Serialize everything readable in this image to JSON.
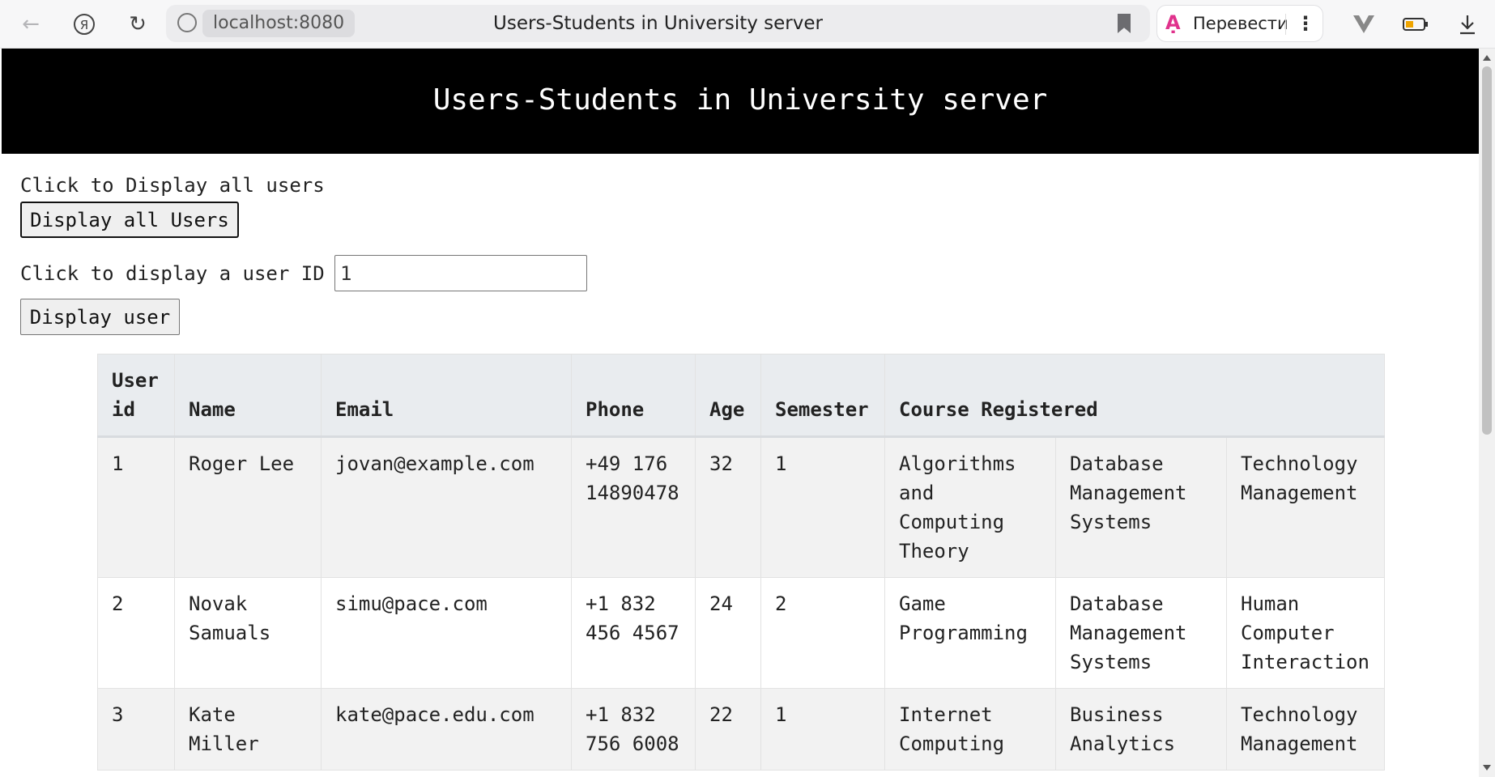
{
  "browser": {
    "url_host": "localhost:8080",
    "tab_title": "Users-Students in University server",
    "translate_label": "Перевести"
  },
  "page": {
    "banner_title": "Users-Students in University server",
    "display_all_prompt": "Click to Display all users",
    "display_all_button": "Display all Users",
    "display_user_prompt": "Click to display a user ID",
    "user_id_value": "1",
    "display_user_button": "Display user"
  },
  "table": {
    "headers": {
      "user_id": "User id",
      "name": "Name",
      "email": "Email",
      "phone": "Phone",
      "age": "Age",
      "semester": "Semester",
      "course": "Course Registered"
    },
    "rows": [
      {
        "id": "1",
        "name": "Roger Lee",
        "email": "jovan@example.com",
        "phone": "+49 176 14890478",
        "age": "32",
        "semester": "1",
        "courses": [
          "Algorithms and Computing Theory",
          "Database Management Systems",
          "Technology Management"
        ]
      },
      {
        "id": "2",
        "name": "Novak Samuals",
        "email": "simu@pace.com",
        "phone": "+1 832 456 4567",
        "age": "24",
        "semester": "2",
        "courses": [
          "Game Programming",
          "Database Management Systems",
          "Human Computer Interaction"
        ]
      },
      {
        "id": "3",
        "name": "Kate Miller",
        "email": "kate@pace.edu.com",
        "phone": "+1 832 756 6008",
        "age": "22",
        "semester": "1",
        "courses": [
          "Internet Computing",
          "Business Analytics",
          "Technology Management"
        ]
      }
    ]
  }
}
